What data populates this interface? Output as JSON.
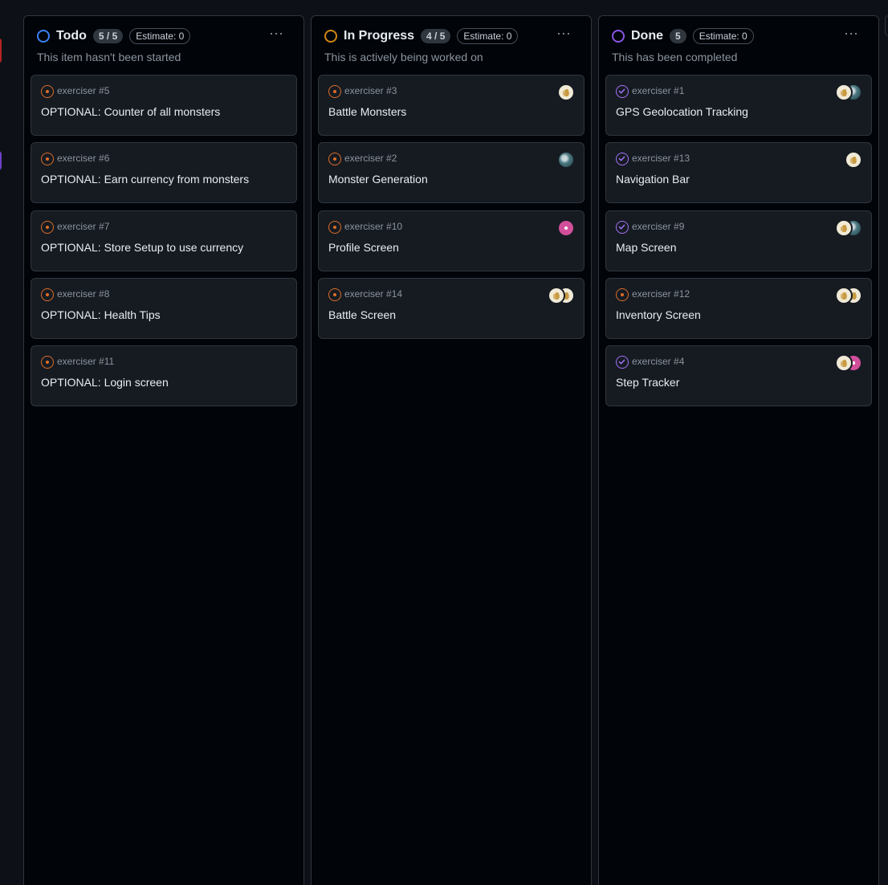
{
  "columns": [
    {
      "id": "todo",
      "title": "Todo",
      "count": "5 / 5",
      "estimate": "Estimate: 0",
      "description": "This item hasn't been started",
      "status_color": "#3b82f6",
      "cards": [
        {
          "ref": "exerciser #5",
          "title": "OPTIONAL: Counter of all monsters",
          "state": "open"
        },
        {
          "ref": "exerciser #6",
          "title": "OPTIONAL: Earn currency from monsters",
          "state": "open"
        },
        {
          "ref": "exerciser #7",
          "title": "OPTIONAL: Store Setup to use currency",
          "state": "open"
        },
        {
          "ref": "exerciser #8",
          "title": "OPTIONAL: Health Tips",
          "state": "open"
        },
        {
          "ref": "exerciser #11",
          "title": "OPTIONAL: Login screen",
          "state": "open"
        }
      ]
    },
    {
      "id": "in-progress",
      "title": "In Progress",
      "count": "4 / 5",
      "estimate": "Estimate: 0",
      "description": "This is actively being worked on",
      "status_color": "#d18616",
      "cards": [
        {
          "ref": "exerciser #3",
          "title": "Battle Monsters",
          "state": "open",
          "avatars": [
            "yellow"
          ]
        },
        {
          "ref": "exerciser #2",
          "title": "Monster Generation",
          "state": "open",
          "avatars": [
            "globe"
          ]
        },
        {
          "ref": "exerciser #10",
          "title": "Profile Screen",
          "state": "open",
          "avatars": [
            "pink"
          ]
        },
        {
          "ref": "exerciser #14",
          "title": "Battle Screen",
          "state": "open",
          "avatars": [
            "yellow",
            "yellow"
          ]
        }
      ]
    },
    {
      "id": "done",
      "title": "Done",
      "count": "5",
      "estimate": "Estimate: 0",
      "description": "This has been completed",
      "status_color": "#8957e5",
      "cards": [
        {
          "ref": "exerciser #1",
          "title": "GPS Geolocation Tracking",
          "state": "closed",
          "avatars": [
            "yellow",
            "globe"
          ]
        },
        {
          "ref": "exerciser #13",
          "title": "Navigation Bar",
          "state": "closed",
          "avatars": [
            "yellow"
          ]
        },
        {
          "ref": "exerciser #9",
          "title": "Map Screen",
          "state": "closed",
          "avatars": [
            "yellow",
            "globe"
          ]
        },
        {
          "ref": "exerciser #12",
          "title": "Inventory Screen",
          "state": "open",
          "avatars": [
            "yellow",
            "yellow"
          ]
        },
        {
          "ref": "exerciser #4",
          "title": "Step Tracker",
          "state": "closed",
          "avatars": [
            "yellow",
            "pink"
          ]
        }
      ]
    }
  ],
  "more_menu_glyph": "···",
  "colors": {
    "background": "#0d1117",
    "column": "#010409",
    "card": "#161b22",
    "border": "#30363d",
    "open_issue": "#db6d28",
    "closed_issue": "#a371f7"
  }
}
